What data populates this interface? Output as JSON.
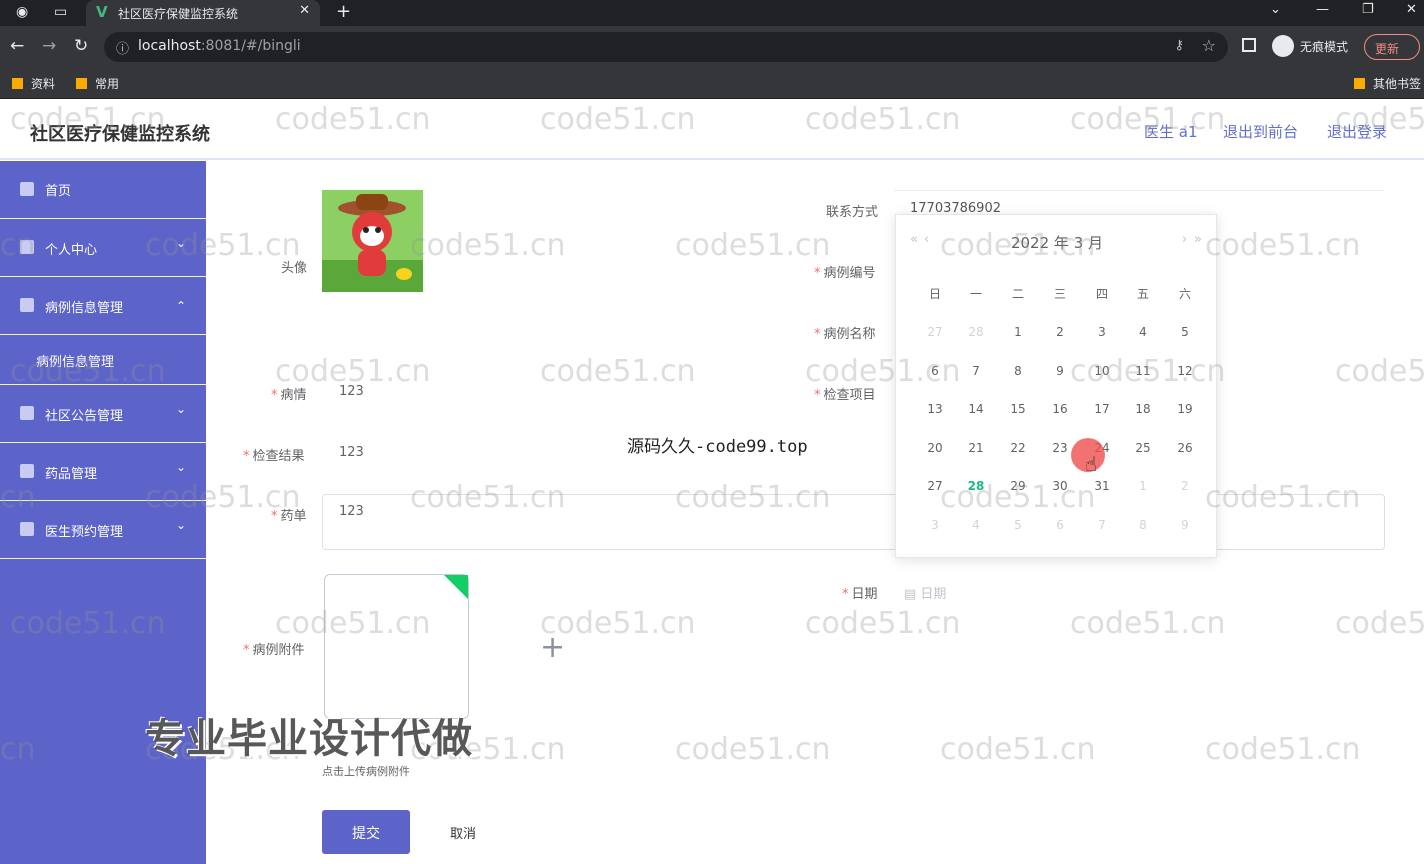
{
  "browser": {
    "tab_title": "社区医疗保健监控系统",
    "url_host": "localhost",
    "url_rest": ":8081/#/bingli",
    "incognito_label": "无痕模式",
    "update_label": "更新",
    "bookmarks": [
      "资料",
      "常用"
    ],
    "other_bookmarks": "其他书签"
  },
  "header": {
    "title": "社区医疗保健监控系统",
    "user": "医生 a1",
    "to_front": "退出到前台",
    "logout": "退出登录"
  },
  "sidebar": {
    "items": [
      {
        "label": "首页",
        "icon": "home-icon"
      },
      {
        "label": "个人中心",
        "icon": "user-icon"
      },
      {
        "label": "病例信息管理",
        "icon": "user-icon"
      },
      {
        "label": "社区公告管理",
        "icon": "notice-icon"
      },
      {
        "label": "药品管理",
        "icon": "list-icon"
      },
      {
        "label": "医生预约管理",
        "icon": "send-icon"
      }
    ],
    "submenu": "病例信息管理"
  },
  "form": {
    "avatar_label": "头像",
    "contact_label": "联系方式",
    "contact_value": "17703786902",
    "case_no_label": "病例编号",
    "case_name_label": "病例名称",
    "condition_label": "病情",
    "condition_value": "123",
    "exam_item_label": "检查项目",
    "exam_result_label": "检查结果",
    "exam_result_value": "123",
    "prescription_label": "药单",
    "prescription_value": "123",
    "attachment_label": "病例附件",
    "attachment_tip": "点击上传病例附件",
    "date_label": "日期",
    "date_placeholder": "日期",
    "submit": "提交",
    "cancel": "取消"
  },
  "datepicker": {
    "year": "2022 年",
    "month": "3 月",
    "weekdays": [
      "日",
      "一",
      "二",
      "三",
      "四",
      "五",
      "六"
    ],
    "weeks": [
      [
        "27",
        "28",
        "1",
        "2",
        "3",
        "4",
        "5"
      ],
      [
        "6",
        "7",
        "8",
        "9",
        "10",
        "11",
        "12"
      ],
      [
        "13",
        "14",
        "15",
        "16",
        "17",
        "18",
        "19"
      ],
      [
        "20",
        "21",
        "22",
        "23",
        "24",
        "25",
        "26"
      ],
      [
        "27",
        "28",
        "29",
        "30",
        "31",
        "1",
        "2"
      ],
      [
        "3",
        "4",
        "5",
        "6",
        "7",
        "8",
        "9"
      ]
    ],
    "today": "28"
  },
  "overlays": {
    "watermark": "code51.cn",
    "center_text": "源码久久-code99.top",
    "promo": "专业毕业设计代做"
  }
}
